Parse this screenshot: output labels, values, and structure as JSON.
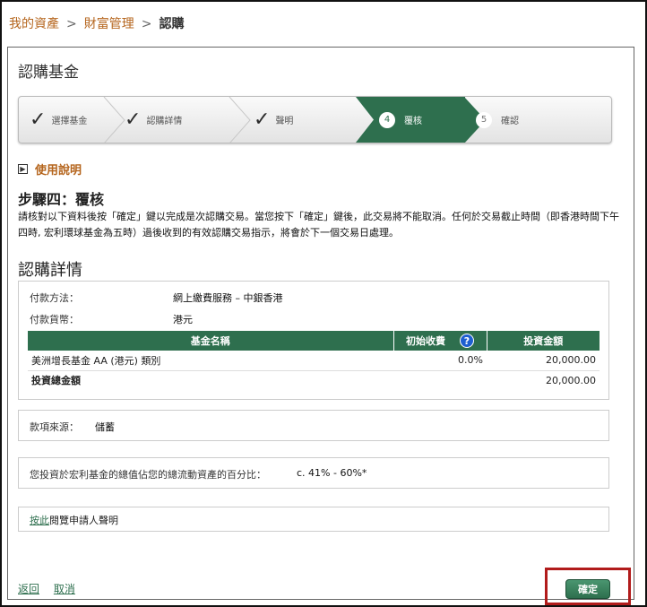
{
  "breadcrumb": {
    "items": [
      "我的資產",
      "財富管理"
    ],
    "current": "認購",
    "separator": ">"
  },
  "page_title": "認購基金",
  "stepper": {
    "steps": [
      {
        "label": "選擇基金",
        "state": "done"
      },
      {
        "label": "認購詳情",
        "state": "done"
      },
      {
        "label": "聲明",
        "state": "done"
      },
      {
        "num": "4",
        "label": "覆核",
        "state": "active"
      },
      {
        "num": "5",
        "label": "確認",
        "state": "pending"
      }
    ]
  },
  "howto": {
    "label": "使用說明"
  },
  "step_heading": "步驟四：覆核",
  "instructions": "請核對以下資料後按「確定」鍵以完成是次認購交易。當您按下「確定」鍵後，此交易將不能取消。任何於交易截止時間（即香港時間下午四時, 宏利環球基金為五時）過後收到的有效認購交易指示，將會於下一個交易日處理。",
  "detail_title": "認購詳情",
  "details": {
    "payment_method_label": "付款方法：",
    "payment_method_value": "網上繳費服務 – 中銀香港",
    "currency_label": "付款貨幣：",
    "currency_value": "港元",
    "table": {
      "headers": [
        "基金名稱",
        "初始收費",
        "投資金額"
      ],
      "rows": [
        {
          "name": "美洲增長基金 AA (港元) 類別",
          "fee": "0.0%",
          "amount": "20,000.00"
        }
      ],
      "total_label": "投資總金額",
      "total_amount": "20,000.00"
    }
  },
  "source": {
    "label": "款項來源：",
    "value": "儲蓄"
  },
  "ratio": {
    "label": "您投資於宏利基金的總值佔您的總流動資產的百分比：",
    "value": "c. 41% - 60%*"
  },
  "declaration": {
    "link": "按此",
    "text": "閱覽申請人聲明"
  },
  "footer": {
    "back": "返回",
    "cancel": "取消"
  },
  "confirm_label": "確定",
  "colors": {
    "accent": "#2e6f4e",
    "link_brown": "#b5651d",
    "highlight_red": "#b11b1b"
  }
}
